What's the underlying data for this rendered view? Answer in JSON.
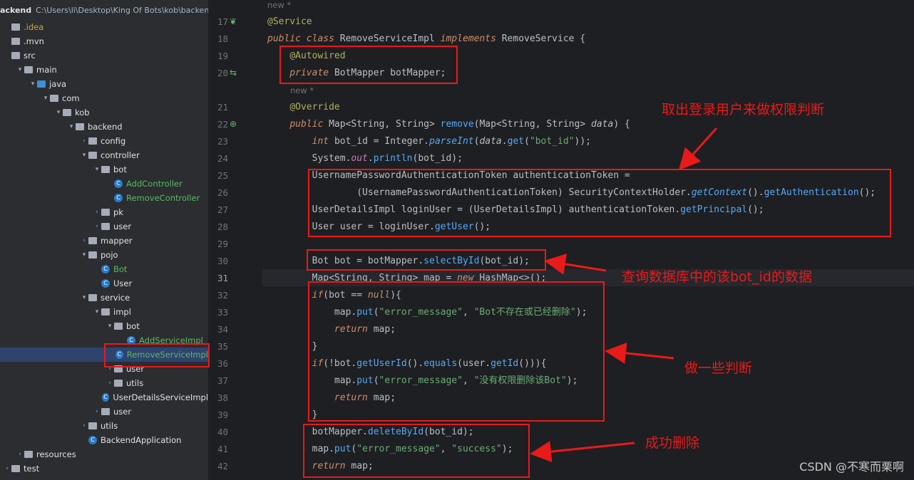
{
  "sidebar": {
    "project_name": "ackend",
    "project_path": "C:\\Users\\li\\Desktop\\King Of Bots\\kob\\backend",
    "items": [
      {
        "label": ".idea",
        "depth": 0,
        "kind": "folder",
        "arrow": "",
        "color": "#c7a54b"
      },
      {
        "label": ".mvn",
        "depth": 0,
        "kind": "folder",
        "arrow": ""
      },
      {
        "label": "src",
        "depth": 0,
        "kind": "folder",
        "arrow": ""
      },
      {
        "label": "main",
        "depth": 1,
        "kind": "folder",
        "arrow": "down"
      },
      {
        "label": "java",
        "depth": 2,
        "kind": "folder-blue",
        "arrow": "down"
      },
      {
        "label": "com",
        "depth": 3,
        "kind": "folder",
        "arrow": "down"
      },
      {
        "label": "kob",
        "depth": 4,
        "kind": "folder",
        "arrow": "down"
      },
      {
        "label": "backend",
        "depth": 5,
        "kind": "folder",
        "arrow": "down"
      },
      {
        "label": "config",
        "depth": 6,
        "kind": "folder",
        "arrow": "right"
      },
      {
        "label": "controller",
        "depth": 6,
        "kind": "folder",
        "arrow": "down"
      },
      {
        "label": "bot",
        "depth": 7,
        "kind": "folder",
        "arrow": "down"
      },
      {
        "label": "AddController",
        "depth": 8,
        "kind": "class",
        "arrow": "",
        "color": "#5fb865"
      },
      {
        "label": "RemoveController",
        "depth": 8,
        "kind": "class",
        "arrow": "",
        "color": "#5fb865"
      },
      {
        "label": "pk",
        "depth": 7,
        "kind": "folder",
        "arrow": "right"
      },
      {
        "label": "user",
        "depth": 7,
        "kind": "folder",
        "arrow": "right"
      },
      {
        "label": "mapper",
        "depth": 6,
        "kind": "folder",
        "arrow": "right"
      },
      {
        "label": "pojo",
        "depth": 6,
        "kind": "folder",
        "arrow": "down"
      },
      {
        "label": "Bot",
        "depth": 7,
        "kind": "class",
        "arrow": "",
        "color": "#5fb865"
      },
      {
        "label": "User",
        "depth": 7,
        "kind": "class",
        "arrow": ""
      },
      {
        "label": "service",
        "depth": 6,
        "kind": "folder",
        "arrow": "down"
      },
      {
        "label": "impl",
        "depth": 7,
        "kind": "folder",
        "arrow": "down"
      },
      {
        "label": "bot",
        "depth": 8,
        "kind": "folder",
        "arrow": "down"
      },
      {
        "label": "AddServiceImpl",
        "depth": 9,
        "kind": "class",
        "arrow": "",
        "color": "#5fb865"
      },
      {
        "label": "RemoveServiceImpl",
        "depth": 9,
        "kind": "class",
        "arrow": "",
        "color": "#5fb865",
        "selected": true
      },
      {
        "label": "user",
        "depth": 8,
        "kind": "folder",
        "arrow": "right"
      },
      {
        "label": "utils",
        "depth": 8,
        "kind": "folder",
        "arrow": "right"
      },
      {
        "label": "UserDetailsServiceImpl",
        "depth": 8,
        "kind": "class",
        "arrow": ""
      },
      {
        "label": "user",
        "depth": 7,
        "kind": "folder",
        "arrow": "right"
      },
      {
        "label": "utils",
        "depth": 6,
        "kind": "folder",
        "arrow": "right"
      },
      {
        "label": "BackendApplication",
        "depth": 6,
        "kind": "app",
        "arrow": ""
      },
      {
        "label": "resources",
        "depth": 1,
        "kind": "folder",
        "arrow": "right"
      },
      {
        "label": "test",
        "depth": 0,
        "kind": "folder",
        "arrow": "right"
      }
    ]
  },
  "editor": {
    "hint_new_top": "new *",
    "hint_new_mid": "new *",
    "line_numbers": [
      "17",
      "18",
      "19",
      "20",
      "",
      "21",
      "22",
      "23",
      "24",
      "25",
      "26",
      "27",
      "28",
      "29",
      "30",
      "31",
      "32",
      "33",
      "34",
      "35",
      "36",
      "37",
      "38",
      "39",
      "40",
      "41",
      "42"
    ],
    "lines": [
      {
        "html": "<span class='ann'>@Service</span>"
      },
      {
        "html": "<span class='kw it'>public class </span>RemoveServiceImpl <span class='kw it'>implements </span>RemoveService {"
      },
      {
        "html": "    <span class='ann'>@Autowired</span>"
      },
      {
        "html": "    <span class='kw it'>private </span>BotMapper botMapper;"
      },
      {
        "html": "HINT"
      },
      {
        "html": "    <span class='ann'>@Override</span>"
      },
      {
        "html": "    <span class='kw it'>public </span>Map&lt;String, String&gt; <span class='fn'>remove</span>(Map&lt;String, String&gt; <span class='it'>data</span>) {"
      },
      {
        "html": "        <span class='kw it'>int </span>bot_id = Integer.<span class='it fn'>parseInt</span>(<span class='it'>data</span>.<span class='fn'>get</span>(<span class='str'>\"bot_id\"</span>));"
      },
      {
        "html": "        System.<span class='fld it'>out</span>.<span class='fn'>println</span>(bot_id);"
      },
      {
        "html": "        UsernamePasswordAuthenticationToken authenticationToken ="
      },
      {
        "html": "                (UsernamePasswordAuthenticationToken) SecurityContextHolder.<span class='it fn'>getContext</span>().<span class='fn'>getAuthentication</span>();"
      },
      {
        "html": "        UserDetailsImpl loginUser = (UserDetailsImpl) authenticationToken.<span class='fn'>getPrincipal</span>();"
      },
      {
        "html": "        User user = loginUser.<span class='fn'>getUser</span>();"
      },
      {
        "html": ""
      },
      {
        "html": "        Bot bot = botMapper.<span class='fn'>selectById</span>(bot_id);"
      },
      {
        "html": "        Map&lt;String, String&gt; map = <span class='kw it'>new </span>HashMap&lt;&gt;();"
      },
      {
        "html": "        <span class='kw it'>if</span>(bot == <span class='kw it'>null</span>){"
      },
      {
        "html": "            map.<span class='fn'>put</span>(<span class='str'>\"error_message\"</span>, <span class='str'>\"Bot不存在或已经删除\"</span>);"
      },
      {
        "html": "            <span class='kw it'>return </span>map;"
      },
      {
        "html": "        }"
      },
      {
        "html": "        <span class='kw it'>if</span>(!bot.<span class='fn'>getUserId</span>().<span class='fn'>equals</span>(user.<span class='fn'>getId</span>())){"
      },
      {
        "html": "            map.<span class='fn'>put</span>(<span class='str'>\"error_message\"</span>, <span class='str'>\"没有权限删除该Bot\"</span>);"
      },
      {
        "html": "            <span class='kw it'>return </span>map;"
      },
      {
        "html": "        }"
      },
      {
        "html": "        botMapper.<span class='fn'>deleteById</span>(bot_id);"
      },
      {
        "html": "        map.<span class='fn'>put</span>(<span class='str'>\"error_message\"</span>, <span class='str'>\"success\"</span>);"
      },
      {
        "html": "        <span class='kw it'>return </span>map;"
      }
    ]
  },
  "annotations": {
    "note1": "取出登录用户来做权限判断",
    "note2": "查询数据库中的该bot_id的数据",
    "note3": "做一些判断",
    "note4": "成功删除"
  },
  "watermark": "CSDN @不寒而栗啊",
  "colors": {
    "annotation_red": "#e81a1a",
    "accent": "#3574f0"
  }
}
